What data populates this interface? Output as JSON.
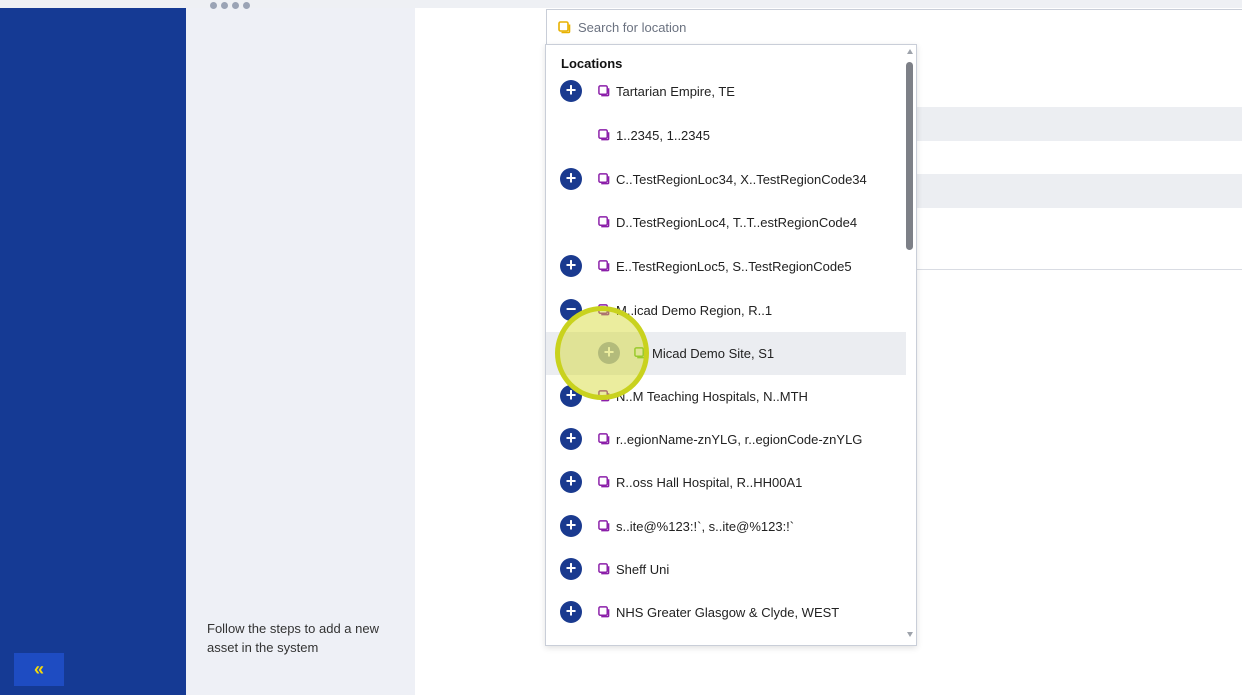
{
  "sidebar": {
    "collapse_label": "«"
  },
  "steps_panel": {
    "hint": "Follow the steps to add a new asset in the system"
  },
  "search": {
    "placeholder": "Search for location",
    "value": ""
  },
  "dropdown": {
    "header": "Locations",
    "items": [
      {
        "label": "Tartarian Empire, TE",
        "expand": "+",
        "icon": "region-icon"
      },
      {
        "label": "1..2345, 1..2345",
        "expand": "",
        "icon": "region-icon"
      },
      {
        "label": "C..TestRegionLoc34, X..TestRegionCode34",
        "expand": "+",
        "icon": "region-icon"
      },
      {
        "label": "D..TestRegionLoc4, T..T..estRegionCode4",
        "expand": "",
        "icon": "region-icon"
      },
      {
        "label": "E..TestRegionLoc5, S..TestRegionCode5",
        "expand": "+",
        "icon": "region-icon"
      },
      {
        "label": "M..icad Demo Region, R..1",
        "expand": "−",
        "icon": "region-icon"
      },
      {
        "label": "Micad Demo Site, S1",
        "expand": "+",
        "icon": "site-icon"
      },
      {
        "label": "N..M Teaching Hospitals, N..MTH",
        "expand": "+",
        "icon": "region-icon"
      },
      {
        "label": "r..egionName-znYLG, r..egionCode-znYLG",
        "expand": "+",
        "icon": "region-icon"
      },
      {
        "label": "R..oss Hall Hospital, R..HH00A1",
        "expand": "+",
        "icon": "region-icon"
      },
      {
        "label": "s..ite@%123:!`, s..ite@%123:!`",
        "expand": "+",
        "icon": "region-icon"
      },
      {
        "label": "Sheff Uni",
        "expand": "+",
        "icon": "region-icon"
      },
      {
        "label": "NHS Greater Glasgow & Clyde, WEST",
        "expand": "+",
        "icon": "region-icon"
      }
    ]
  },
  "colors": {
    "nav_blue": "#153a94",
    "node_blue": "#1a3a8f",
    "region_icon": "#8b1fa9",
    "site_icon": "#6abf2e",
    "search_icon": "#e8b100",
    "accent_yellow": "#f5d90a"
  }
}
